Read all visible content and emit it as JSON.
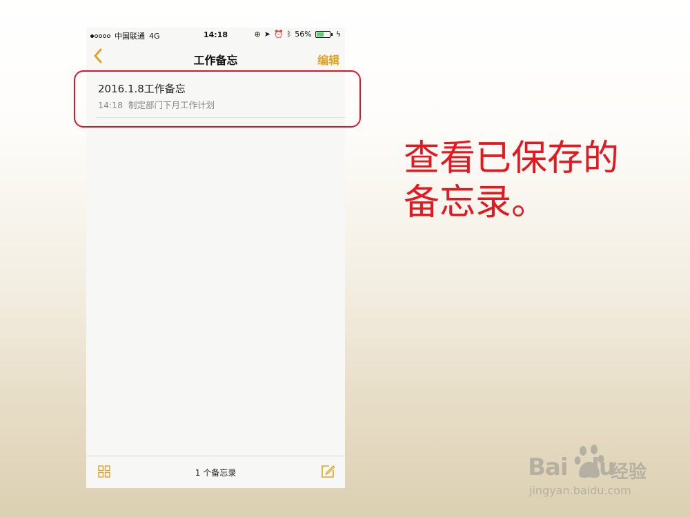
{
  "statusbar": {
    "carrier": "中国联通",
    "network": "4G",
    "time": "14:18",
    "battery": "56%",
    "battery_level": 0.56
  },
  "navbar": {
    "back_icon": "chevron-left-icon",
    "title": "工作备忘",
    "edit_label": "编辑"
  },
  "notes": [
    {
      "title": "2016.1.8工作备忘",
      "time": "14:18",
      "preview": "制定部门下月工作计划"
    }
  ],
  "toolbar": {
    "count": "1 个备忘录",
    "left_icon": "grid-icon",
    "right_icon": "compose-icon"
  },
  "annotation": {
    "caption_line1": "查看已保存的",
    "caption_line2": "备忘录。"
  },
  "watermark": {
    "brand": "Bai",
    "brand2": "du",
    "cn": "经验",
    "url": "jingyan.baidu.com"
  },
  "colors": {
    "accent": "#e0a326",
    "annotation_red": "#e4181f"
  }
}
